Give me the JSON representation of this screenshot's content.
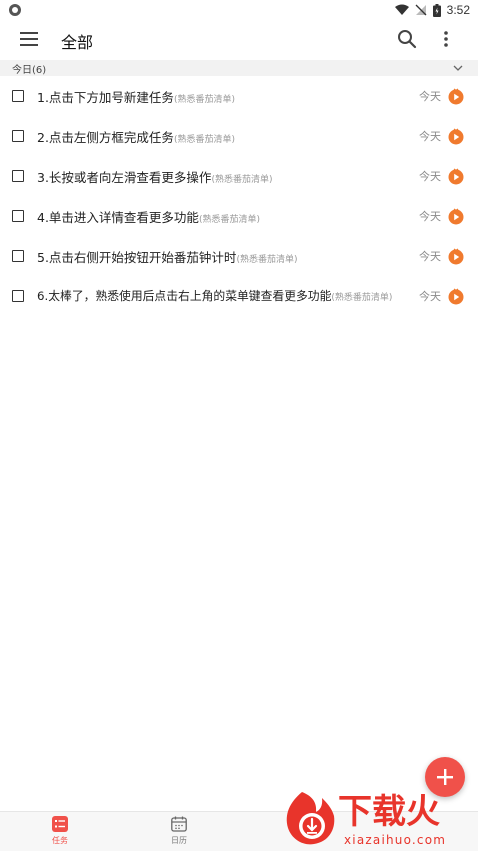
{
  "status_bar": {
    "time": "3:52"
  },
  "header": {
    "title": "全部"
  },
  "section": {
    "label": "今日(6)"
  },
  "tasks": [
    {
      "text": "1.点击下方加号新建任务",
      "tag": "(熟悉番茄清单)",
      "date": "今天"
    },
    {
      "text": "2.点击左侧方框完成任务",
      "tag": "(熟悉番茄清单)",
      "date": "今天"
    },
    {
      "text": "3.长按或者向左滑查看更多操作",
      "tag": "(熟悉番茄清单)",
      "date": "今天"
    },
    {
      "text": "4.单击进入详情查看更多功能",
      "tag": "(熟悉番茄清单)",
      "date": "今天"
    },
    {
      "text": "5.点击右侧开始按钮开始番茄钟计时",
      "tag": "(熟悉番茄清单)",
      "date": "今天"
    },
    {
      "text": "6.太棒了，熟悉使用后点击右上角的菜单键查看更多功能",
      "tag": "(熟悉番茄清单)",
      "date": "今天"
    }
  ],
  "bottom_nav": {
    "tasks_label": "任务",
    "calendar_label": "日历"
  },
  "watermark": {
    "title": "下载火",
    "domain": "xiazaihuo.com"
  },
  "colors": {
    "accent": "#f0514a",
    "play_icon": "#f07a2e",
    "watermark": "#e8342b"
  },
  "icons": {
    "menu": "menu-icon",
    "search": "search-icon",
    "more": "more-vertical-icon",
    "chevron": "chevron-down-icon",
    "play": "tomato-play-icon",
    "add": "plus-icon",
    "tasks_tab": "task-list-icon",
    "calendar_tab": "calendar-icon"
  }
}
